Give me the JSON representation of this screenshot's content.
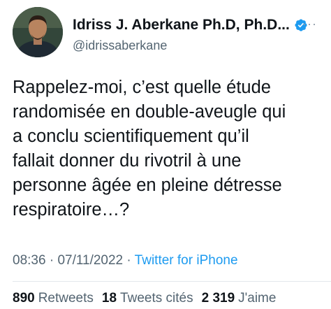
{
  "user": {
    "display_name": "Idriss J. Aberkane Ph.D, Ph.D...",
    "handle": "@idrissaberkane",
    "verified_icon": "verified-badge-icon",
    "more_label": "···"
  },
  "tweet": {
    "text": "Rappelez-moi, c’est quelle étude\nrandomisée en double-aveugle qui\na conclu scientifiquement qu’il\nfallait donner du rivotril à une\npersonne âgée en pleine détresse\nrespiratoire…?",
    "time": "08:36",
    "separator": "·",
    "date": "07/11/2022",
    "source": "Twitter for iPhone"
  },
  "stats": {
    "retweets_count": "890",
    "retweets_label": "Retweets",
    "quotes_count": "18",
    "quotes_label": "Tweets cités",
    "likes_count": "2 319",
    "likes_label": "J'aime"
  },
  "colors": {
    "link": "#1d9bf0",
    "muted": "#536471",
    "text": "#0f1419"
  }
}
